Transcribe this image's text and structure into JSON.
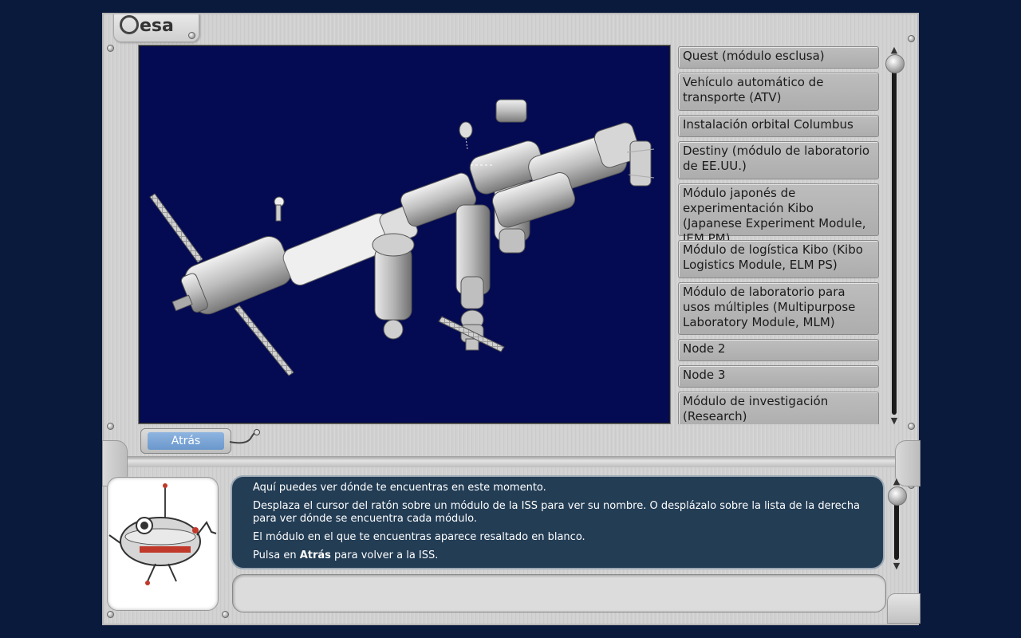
{
  "header": {
    "logo_text": "esa"
  },
  "viewer": {
    "label": "ISS 3D module view"
  },
  "module_list": [
    {
      "label": "Quest (módulo esclusa)"
    },
    {
      "label": "Vehículo automático de transporte (ATV)"
    },
    {
      "label": "Instalación orbital Columbus"
    },
    {
      "label": "Destiny (módulo de laboratorio de EE.UU.)"
    },
    {
      "label": "Módulo japonés de experimentación Kibo (Japanese Experiment Module, JEM PM)"
    },
    {
      "label": "Módulo de logística Kibo (Kibo Logistics Module, ELM PS)"
    },
    {
      "label": "Módulo de laboratorio para usos múltiples (Multipurpose Laboratory Module, MLM)"
    },
    {
      "label": "Node 2"
    },
    {
      "label": "Node 3"
    },
    {
      "label": "Módulo de investigación (Research)"
    }
  ],
  "back_button": {
    "label": "Atrás"
  },
  "message": {
    "line1": "Aquí puedes ver dónde te encuentras en este momento.",
    "line2": "Desplaza el cursor del ratón sobre un módulo de la ISS para ver su nombre. O desplázalo sobre la lista de la derecha para ver dónde se encuentra cada módulo.",
    "line3": "El módulo en el que te encuentras aparece resaltado en blanco.",
    "line4_prefix": "Pulsa en ",
    "line4_bold": "Atrás",
    "line4_suffix": " para volver a la ISS."
  },
  "icons": {
    "scroll_up": "triangle-up-icon",
    "scroll_down": "triangle-down-icon",
    "scroll_thumb": "scroll-knob-icon",
    "robot": "robot-mascot-icon"
  }
}
